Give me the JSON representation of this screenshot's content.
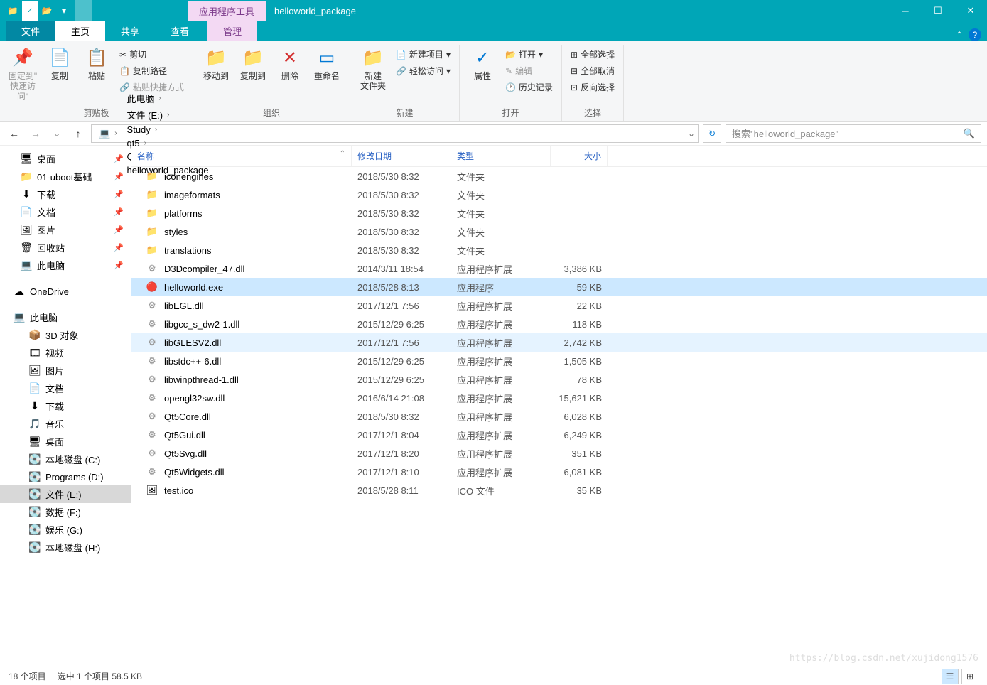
{
  "title": {
    "tool_tab": "应用程序工具",
    "window": "helloworld_package"
  },
  "tabs": {
    "file": "文件",
    "home": "主页",
    "share": "共享",
    "view": "查看",
    "manage": "管理"
  },
  "ribbon": {
    "pin": "固定到\"\n快速访问\"",
    "copy": "复制",
    "paste": "粘贴",
    "cut": "剪切",
    "copypath": "复制路径",
    "pasteshort": "粘贴快捷方式",
    "clipboard": "剪贴板",
    "moveto": "移动到",
    "copyto": "复制到",
    "delete": "删除",
    "rename": "重命名",
    "organize": "组织",
    "newfolder": "新建\n文件夹",
    "newitem": "新建项目",
    "easyaccess": "轻松访问",
    "new": "新建",
    "properties": "属性",
    "open": "打开",
    "edit": "编辑",
    "history": "历史记录",
    "openg": "打开",
    "selectall": "全部选择",
    "selectnone": "全部取消",
    "invertsel": "反向选择",
    "select": "选择"
  },
  "breadcrumb": [
    "此电脑",
    "文件 (E:)",
    "Study",
    "qt5",
    "Qt Project",
    "helloworld_package"
  ],
  "search_placeholder": "搜索\"helloworld_package\"",
  "nav": {
    "quick": [
      {
        "label": "桌面",
        "icon": "🖥",
        "pin": true
      },
      {
        "label": "01-uboot基础",
        "icon": "📁",
        "pin": true
      },
      {
        "label": "下载",
        "icon": "⬇",
        "pin": true
      },
      {
        "label": "文档",
        "icon": "📄",
        "pin": true
      },
      {
        "label": "图片",
        "icon": "🖼",
        "pin": true
      },
      {
        "label": "回收站",
        "icon": "🗑",
        "pin": true
      },
      {
        "label": "此电脑",
        "icon": "💻",
        "pin": true
      }
    ],
    "onedrive": "OneDrive",
    "pc": "此电脑",
    "pcitems": [
      {
        "label": "3D 对象",
        "icon": "📦"
      },
      {
        "label": "视频",
        "icon": "🎞"
      },
      {
        "label": "图片",
        "icon": "🖼"
      },
      {
        "label": "文档",
        "icon": "📄"
      },
      {
        "label": "下载",
        "icon": "⬇"
      },
      {
        "label": "音乐",
        "icon": "🎵"
      },
      {
        "label": "桌面",
        "icon": "🖥"
      },
      {
        "label": "本地磁盘 (C:)",
        "icon": "💽"
      },
      {
        "label": "Programs (D:)",
        "icon": "💽"
      },
      {
        "label": "文件 (E:)",
        "icon": "💽",
        "sel": true
      },
      {
        "label": "数据 (F:)",
        "icon": "💽"
      },
      {
        "label": "娱乐 (G:)",
        "icon": "💽"
      },
      {
        "label": "本地磁盘 (H:)",
        "icon": "💽"
      }
    ]
  },
  "columns": {
    "name": "名称",
    "date": "修改日期",
    "type": "类型",
    "size": "大小"
  },
  "files": [
    {
      "name": "iconengines",
      "date": "2018/5/30 8:32",
      "type": "文件夹",
      "size": "",
      "icon": "folder"
    },
    {
      "name": "imageformats",
      "date": "2018/5/30 8:32",
      "type": "文件夹",
      "size": "",
      "icon": "folder"
    },
    {
      "name": "platforms",
      "date": "2018/5/30 8:32",
      "type": "文件夹",
      "size": "",
      "icon": "folder"
    },
    {
      "name": "styles",
      "date": "2018/5/30 8:32",
      "type": "文件夹",
      "size": "",
      "icon": "folder"
    },
    {
      "name": "translations",
      "date": "2018/5/30 8:32",
      "type": "文件夹",
      "size": "",
      "icon": "folder"
    },
    {
      "name": "D3Dcompiler_47.dll",
      "date": "2014/3/11 18:54",
      "type": "应用程序扩展",
      "size": "3,386 KB",
      "icon": "dll"
    },
    {
      "name": "helloworld.exe",
      "date": "2018/5/28 8:13",
      "type": "应用程序",
      "size": "59 KB",
      "icon": "exe",
      "sel": true
    },
    {
      "name": "libEGL.dll",
      "date": "2017/12/1 7:56",
      "type": "应用程序扩展",
      "size": "22 KB",
      "icon": "dll"
    },
    {
      "name": "libgcc_s_dw2-1.dll",
      "date": "2015/12/29 6:25",
      "type": "应用程序扩展",
      "size": "118 KB",
      "icon": "dll"
    },
    {
      "name": "libGLESV2.dll",
      "date": "2017/12/1 7:56",
      "type": "应用程序扩展",
      "size": "2,742 KB",
      "icon": "dll",
      "hov": true
    },
    {
      "name": "libstdc++-6.dll",
      "date": "2015/12/29 6:25",
      "type": "应用程序扩展",
      "size": "1,505 KB",
      "icon": "dll"
    },
    {
      "name": "libwinpthread-1.dll",
      "date": "2015/12/29 6:25",
      "type": "应用程序扩展",
      "size": "78 KB",
      "icon": "dll"
    },
    {
      "name": "opengl32sw.dll",
      "date": "2016/6/14 21:08",
      "type": "应用程序扩展",
      "size": "15,621 KB",
      "icon": "dll"
    },
    {
      "name": "Qt5Core.dll",
      "date": "2018/5/30 8:32",
      "type": "应用程序扩展",
      "size": "6,028 KB",
      "icon": "dll"
    },
    {
      "name": "Qt5Gui.dll",
      "date": "2017/12/1 8:04",
      "type": "应用程序扩展",
      "size": "6,249 KB",
      "icon": "dll"
    },
    {
      "name": "Qt5Svg.dll",
      "date": "2017/12/1 8:20",
      "type": "应用程序扩展",
      "size": "351 KB",
      "icon": "dll"
    },
    {
      "name": "Qt5Widgets.dll",
      "date": "2017/12/1 8:10",
      "type": "应用程序扩展",
      "size": "6,081 KB",
      "icon": "dll"
    },
    {
      "name": "test.ico",
      "date": "2018/5/28 8:11",
      "type": "ICO 文件",
      "size": "35 KB",
      "icon": "ico"
    }
  ],
  "status": {
    "items": "18 个项目",
    "selected": "选中 1 个项目  58.5 KB"
  },
  "watermark": "https://blog.csdn.net/xujidong1576"
}
